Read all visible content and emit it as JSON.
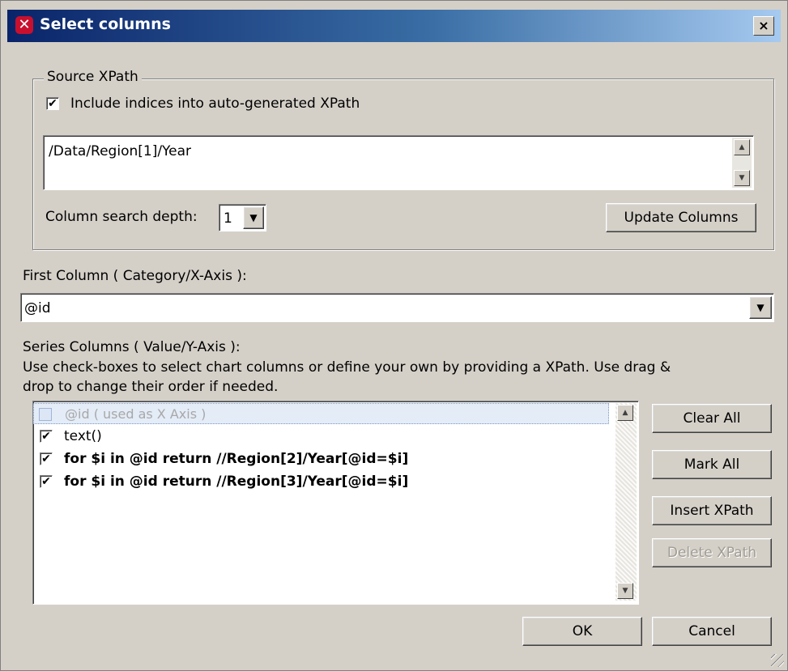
{
  "window": {
    "title": "Select columns",
    "close_label": "×"
  },
  "source_xpath": {
    "group_label": "Source XPath",
    "include_indices_label": "Include indices into auto-generated XPath",
    "include_indices_checked": true,
    "xpath_value": "/Data/Region[1]/Year",
    "search_depth_label": "Column search depth:",
    "search_depth_value": "1",
    "update_button": "Update Columns"
  },
  "first_column": {
    "label": "First Column ( Category/X-Axis ):",
    "value": "@id"
  },
  "series_columns": {
    "label": "Series Columns ( Value/Y-Axis ):",
    "help_line1": "Use check-boxes to select chart columns or define your own by providing a XPath. Use drag &",
    "help_line2": "drop to change their order if needed.",
    "items": [
      {
        "label": "@id ( used as X Axis )",
        "checked": false,
        "disabled": true
      },
      {
        "label": "text()",
        "checked": true,
        "disabled": false
      },
      {
        "label": "for $i in @id return //Region[2]/Year[@id=$i]",
        "checked": true,
        "disabled": false
      },
      {
        "label": "for $i in @id return //Region[3]/Year[@id=$i]",
        "checked": true,
        "disabled": false
      }
    ]
  },
  "side_buttons": {
    "clear_all": "Clear All",
    "mark_all": "Mark All",
    "insert_xpath": "Insert XPath",
    "delete_xpath": "Delete XPath"
  },
  "footer": {
    "ok": "OK",
    "cancel": "Cancel"
  },
  "icons": {
    "check_glyph": "✔",
    "up": "▲",
    "down": "▼"
  }
}
